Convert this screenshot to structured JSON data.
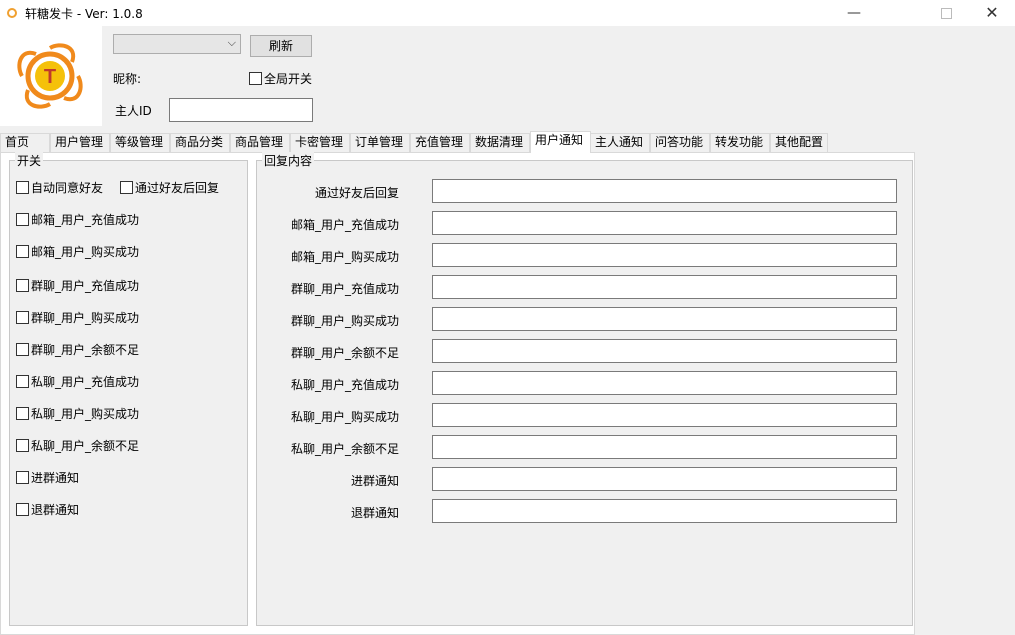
{
  "window": {
    "title": "轩糖发卡 - Ver:  1.0.8",
    "minimize": "—",
    "close": "✕"
  },
  "header": {
    "logo_letter": "T",
    "account_select_value": "",
    "refresh_label": "刷新",
    "nickname_label": "昵称:",
    "global_switch_label": "全局开关",
    "owner_id_label": "主人ID",
    "owner_id_value": ""
  },
  "tabs": [
    "首页",
    "用户管理",
    "等级管理",
    "商品分类",
    "商品管理",
    "卡密管理",
    "订单管理",
    "充值管理",
    "数据清理",
    "用户通知",
    "主人通知",
    "问答功能",
    "转发功能",
    "其他配置"
  ],
  "active_tab": "用户通知",
  "switch_group": {
    "title": "开关",
    "items": [
      "自动同意好友",
      "通过好友后回复",
      "邮箱_用户_充值成功",
      "邮箱_用户_购买成功",
      "群聊_用户_充值成功",
      "群聊_用户_购买成功",
      "群聊_用户_余额不足",
      "私聊_用户_充值成功",
      "私聊_用户_购买成功",
      "私聊_用户_余额不足",
      "进群通知",
      "退群通知"
    ]
  },
  "reply_group": {
    "title": "回复内容",
    "rows": [
      {
        "label": "通过好友后回复",
        "value": ""
      },
      {
        "label": "邮箱_用户_充值成功",
        "value": ""
      },
      {
        "label": "邮箱_用户_购买成功",
        "value": ""
      },
      {
        "label": "群聊_用户_充值成功",
        "value": ""
      },
      {
        "label": "群聊_用户_购买成功",
        "value": ""
      },
      {
        "label": "群聊_用户_余额不足",
        "value": ""
      },
      {
        "label": "私聊_用户_充值成功",
        "value": ""
      },
      {
        "label": "私聊_用户_购买成功",
        "value": ""
      },
      {
        "label": "私聊_用户_余额不足",
        "value": ""
      },
      {
        "label": "进群通知",
        "value": ""
      },
      {
        "label": "退群通知",
        "value": ""
      }
    ]
  },
  "colors": {
    "logo_orange": "#f08a1c",
    "logo_yellow": "#f5c10a"
  }
}
